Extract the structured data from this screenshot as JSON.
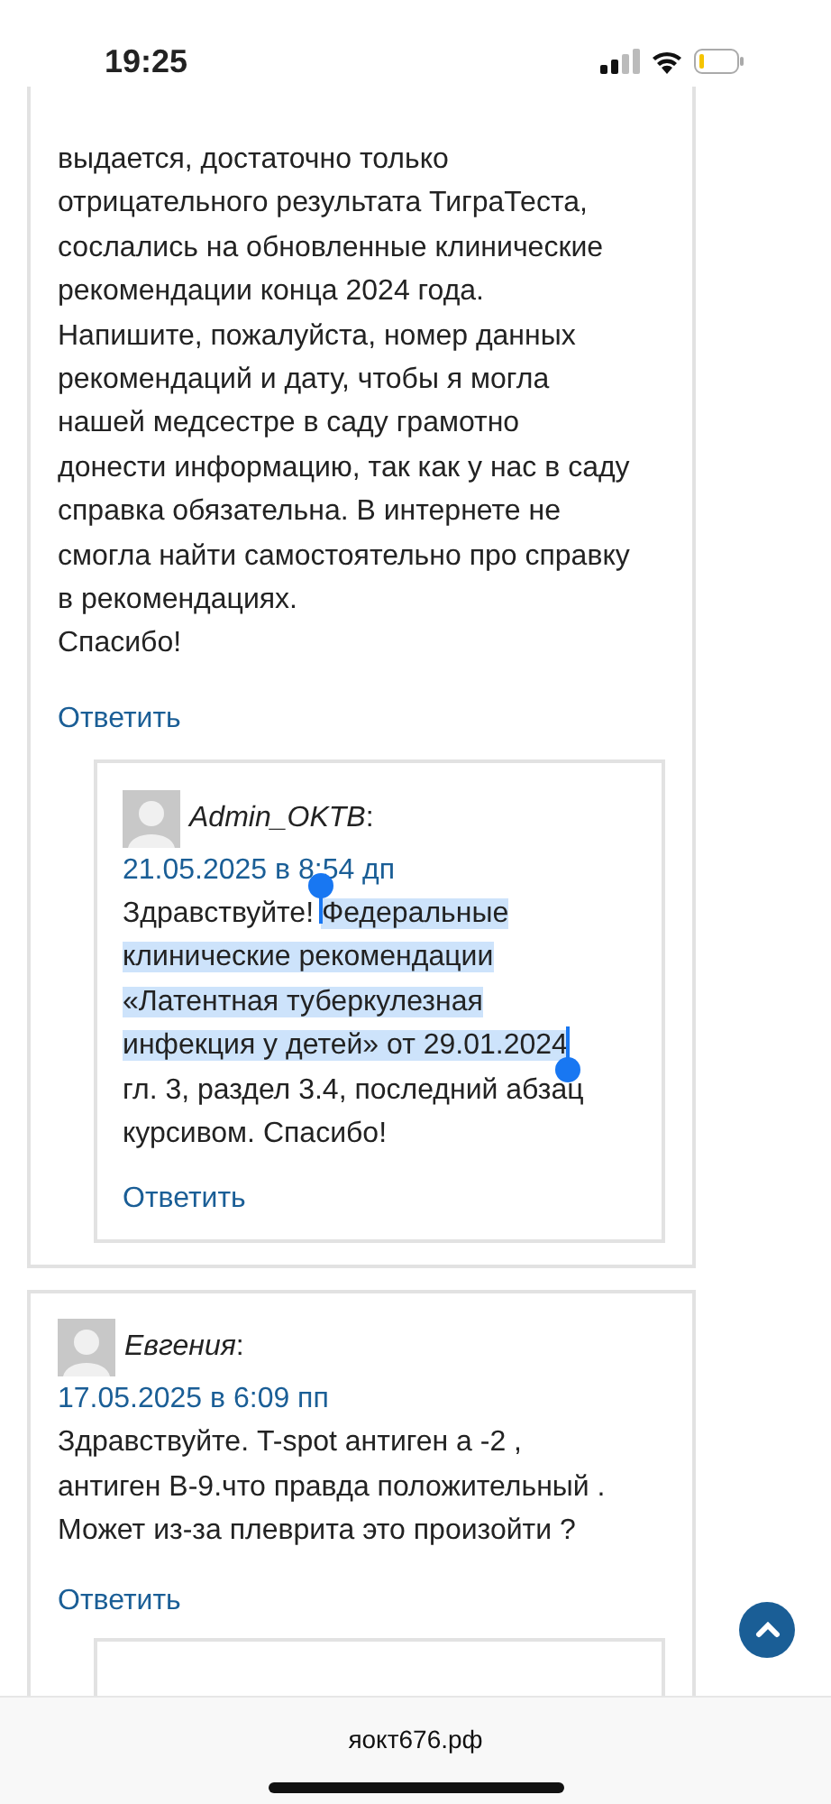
{
  "status_bar": {
    "time": "19:25"
  },
  "comments": [
    {
      "lines": [
        "выдается, достаточно только",
        "отрицательного результата ТиграТеста,",
        "сослались на обновленные клинические",
        "рекомендации конца 2024 года.",
        "Напишите, пожалуйста, номер данных",
        "рекомендаций и дату, чтобы я могла",
        "нашей медсестре в саду грамотно",
        "донести информацию, так как у нас в саду",
        "справка обязательна. В интернете не",
        "смогла найти самостоятельно про справку",
        "в рекомендациях.",
        "Спасибо!"
      ],
      "reply_link": "Ответить",
      "replies": [
        {
          "author": "Admin_OKTB",
          "author_suffix": ":",
          "date": "21.05.2025 в 8:54 дп",
          "lines": [
            [
              {
                "text": "Здравствуйте! ",
                "selected": false
              },
              {
                "text": "Федеральные",
                "selected": true
              }
            ],
            [
              {
                "text": "клинические рекомендации",
                "selected": true
              }
            ],
            [
              {
                "text": "«Латентная туберкулезная",
                "selected": true
              }
            ],
            [
              {
                "text": "инфекция у детей» от 29.01.2024",
                "selected": true
              }
            ],
            [
              {
                "text": "гл. 3, раздел 3.4, последний абзац",
                "selected": false
              }
            ],
            [
              {
                "text": "курсивом. Спасибо!",
                "selected": false
              }
            ]
          ],
          "reply_link": "Ответить"
        }
      ]
    },
    {
      "author": "Евгения",
      "author_suffix": ":",
      "date": "17.05.2025 в 6:09 пп",
      "lines": [
        "Здравствуйте. T-spot антиген а -2 ,",
        "антиген В-9.что правда положительный .",
        "Может из-за плеврита это произойти ?"
      ],
      "reply_link": "Ответить",
      "has_nested_reply": true
    }
  ],
  "browser_bar": {
    "url": "яокт676.рф"
  }
}
